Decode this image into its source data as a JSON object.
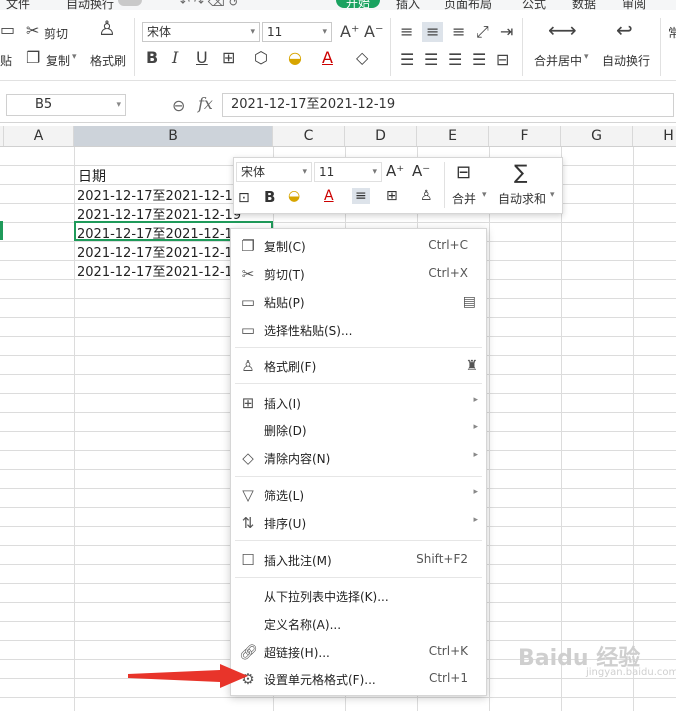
{
  "menu": {
    "items": [
      "文件",
      "自动换行",
      "开始",
      "插入",
      "页面布局",
      "公式",
      "数据",
      "审阅"
    ]
  },
  "ribbon": {
    "cut": "剪切",
    "copy": "复制",
    "paste_fragment": "贴",
    "format_painter": "格式刷",
    "font_name": "宋体",
    "font_size": "11",
    "merge_center": "合并居中",
    "wrap_text": "自动换行",
    "normal_fragment": "常"
  },
  "formula_bar": {
    "cell_ref": "B5",
    "content": "2021-12-17至2021-12-19"
  },
  "columns": [
    "A",
    "B",
    "C",
    "D",
    "E",
    "F",
    "G",
    "H"
  ],
  "cells": {
    "header": "日期",
    "rows": [
      "2021-12-17至2021-12-19",
      "2021-12-17至2021-12-19",
      "2021-12-17至2021-12-19",
      "2021-12-17至2021-12-19",
      "2021-12-17至2021-12-19"
    ]
  },
  "mini_toolbar": {
    "font_name": "宋体",
    "font_size": "11",
    "merge": "合并",
    "autosum": "自动求和"
  },
  "context_menu": {
    "items": [
      {
        "label": "复制(C)",
        "shortcut": "Ctrl+C",
        "icon": "copy-icon"
      },
      {
        "label": "剪切(T)",
        "shortcut": "Ctrl+X",
        "icon": "scissors-icon"
      },
      {
        "label": "粘贴(P)",
        "shortcut": "",
        "icon": "paste-icon"
      },
      {
        "label": "选择性粘贴(S)...",
        "shortcut": "",
        "icon": "paste-special-icon"
      },
      {
        "label": "格式刷(F)",
        "shortcut": "",
        "icon": "format-painter-icon"
      },
      {
        "label": "插入(I)",
        "shortcut": "",
        "icon": "insert-icon"
      },
      {
        "label": "删除(D)",
        "shortcut": "",
        "icon": ""
      },
      {
        "label": "清除内容(N)",
        "shortcut": "",
        "icon": "eraser-icon"
      },
      {
        "label": "筛选(L)",
        "shortcut": "",
        "icon": "filter-icon"
      },
      {
        "label": "排序(U)",
        "shortcut": "",
        "icon": "sort-icon"
      },
      {
        "label": "插入批注(M)",
        "shortcut": "Shift+F2",
        "icon": "comment-icon"
      },
      {
        "label": "从下拉列表中选择(K)...",
        "shortcut": "",
        "icon": ""
      },
      {
        "label": "定义名称(A)...",
        "shortcut": "",
        "icon": ""
      },
      {
        "label": "超链接(H)...",
        "shortcut": "Ctrl+K",
        "icon": "link-icon"
      },
      {
        "label": "设置单元格格式(F)...",
        "shortcut": "Ctrl+1",
        "icon": "format-cells-icon"
      }
    ]
  },
  "watermark": {
    "text": "Baidu 经验",
    "sub": "jingyan.baidu.com"
  },
  "colors": {
    "accent_green": "#1aa260",
    "selection_border": "#1f9a5a",
    "arrow_red": "#e8342a"
  }
}
